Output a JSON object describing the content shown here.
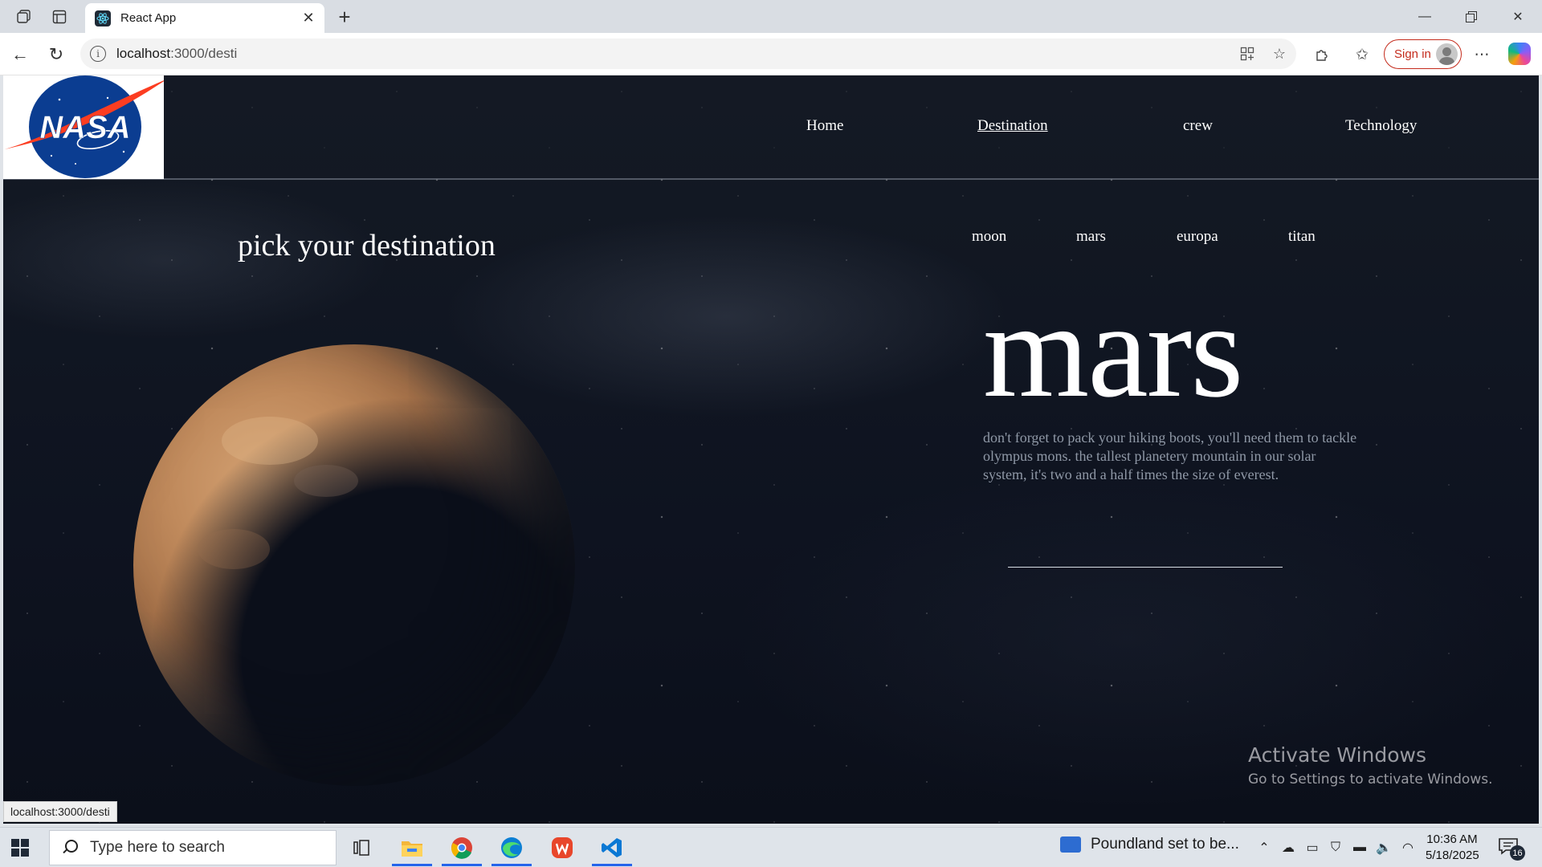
{
  "browser": {
    "tab_title": "React App",
    "url_host": "localhost",
    "url_path": ":3000/desti",
    "signin_label": "Sign in"
  },
  "site": {
    "logo_text": "NASA",
    "nav": [
      {
        "label": "Home"
      },
      {
        "label": "Destination",
        "active": true
      },
      {
        "label": "crew"
      },
      {
        "label": "Technology"
      }
    ],
    "heading": "pick your destination",
    "destination_tabs": [
      {
        "label": "moon"
      },
      {
        "label": "mars"
      },
      {
        "label": "europa"
      },
      {
        "label": "titan"
      }
    ],
    "destination_name": "mars",
    "destination_description": "don't forget to pack your hiking boots, you'll need them to tackle olympus mons. the tallest planetery mountain in our solar system, it's two and a half times the size of everest."
  },
  "overlay": {
    "activate_title": "Activate Windows",
    "activate_sub": "Go to Settings to activate Windows."
  },
  "status_url": "localhost:3000/desti",
  "taskbar": {
    "search_placeholder": "Type here to search",
    "news_text": "Poundland set to be...",
    "time": "10:36 AM",
    "date": "5/18/2025",
    "notification_count": "16"
  },
  "colors": {
    "signin_accent": "#c42b1c",
    "page_background": "#0e1320",
    "description_text": "#8f98a6"
  }
}
